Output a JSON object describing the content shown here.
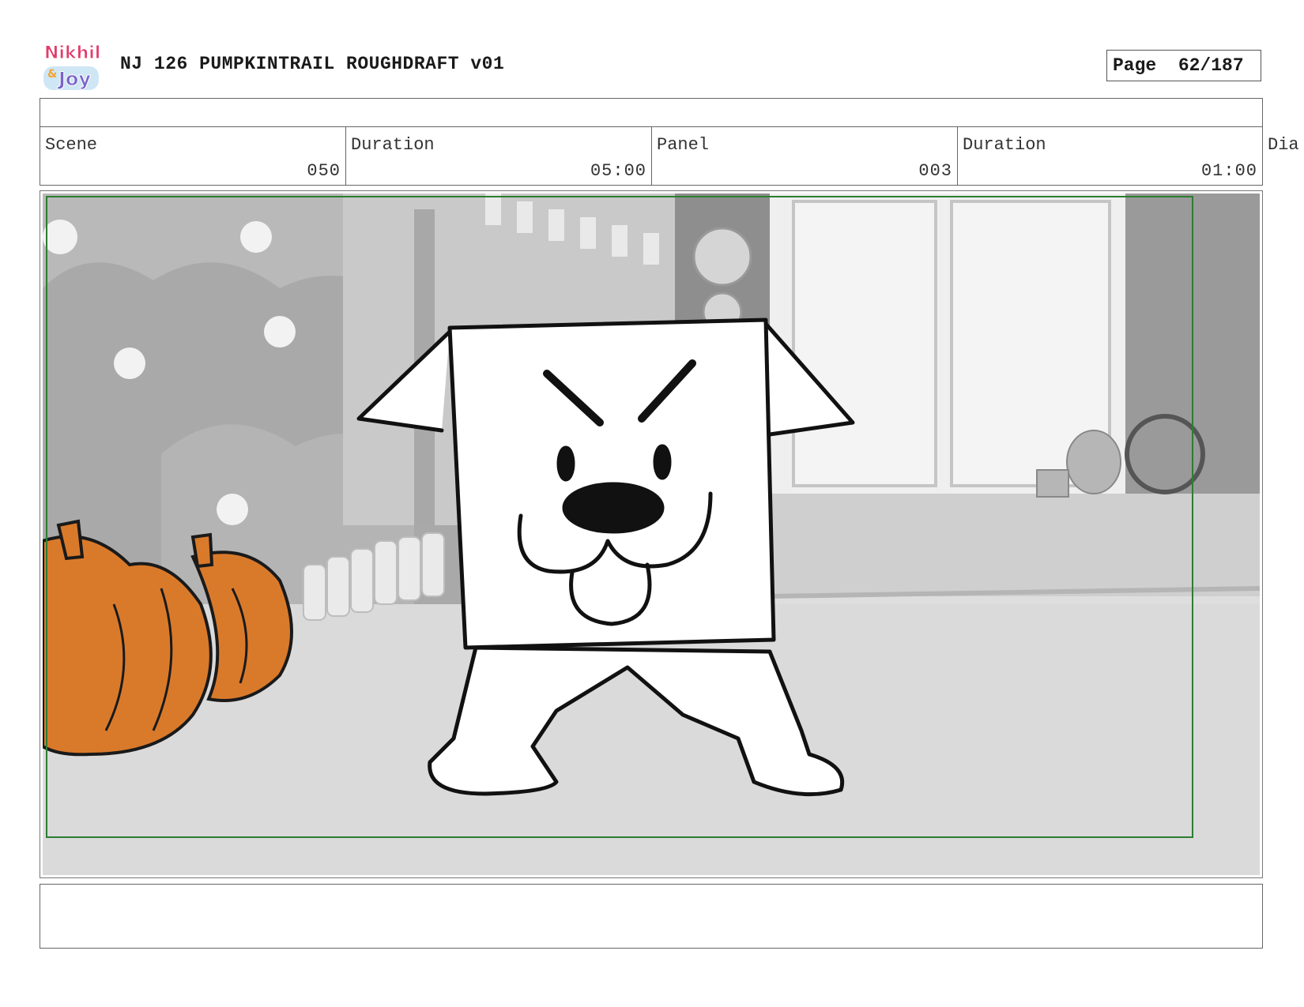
{
  "header": {
    "logo_text": "Nikhil & Joy",
    "title": "NJ 126 PUMPKINTRAIL ROUGHDRAFT v01",
    "page_label": "Page",
    "page_number": "62/187"
  },
  "meta": {
    "scene_label": "Scene",
    "scene_value": "050",
    "scene_duration_label": "Duration",
    "scene_duration_value": "05:00",
    "panel_label": "Panel",
    "panel_value": "003",
    "panel_duration_label": "Duration",
    "panel_duration_value": "01:00",
    "dialogue_label": "Dia"
  },
  "panel": {
    "description": "",
    "safe_frame_color": "#2e7d32",
    "pumpkin_color": "#d97a2b"
  },
  "notes": ""
}
